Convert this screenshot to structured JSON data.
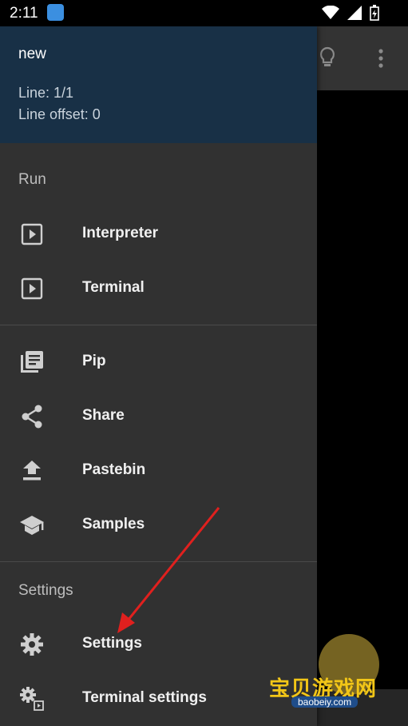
{
  "status_bar": {
    "time": "2:11",
    "icons": [
      "app-notification-icon",
      "wifi-icon",
      "signal-icon",
      "battery-charging-icon"
    ]
  },
  "app_bar": {
    "icons": [
      "lightbulb-icon",
      "more-vert-icon"
    ]
  },
  "drawer": {
    "header": {
      "title": "new",
      "line": "Line: 1/1",
      "line_offset": "Line offset: 0"
    },
    "sections": [
      {
        "label": "Run",
        "items": [
          {
            "label": "Interpreter",
            "icon": "play-box-icon"
          },
          {
            "label": "Terminal",
            "icon": "play-box-icon"
          }
        ]
      },
      {
        "label": "",
        "items": [
          {
            "label": "Pip",
            "icon": "library-books-icon"
          },
          {
            "label": "Share",
            "icon": "share-icon"
          },
          {
            "label": "Pastebin",
            "icon": "upload-icon"
          },
          {
            "label": "Samples",
            "icon": "school-icon"
          }
        ]
      },
      {
        "label": "Settings",
        "items": [
          {
            "label": "Settings",
            "icon": "gear-icon"
          },
          {
            "label": "Terminal settings",
            "icon": "gear-play-icon"
          }
        ]
      }
    ]
  },
  "watermark": {
    "text": "宝贝游戏网",
    "url": "baobeiy.com"
  },
  "colors": {
    "drawer_bg": "#313131",
    "header_bg": "#183046",
    "annotation_arrow": "#e0201e"
  }
}
